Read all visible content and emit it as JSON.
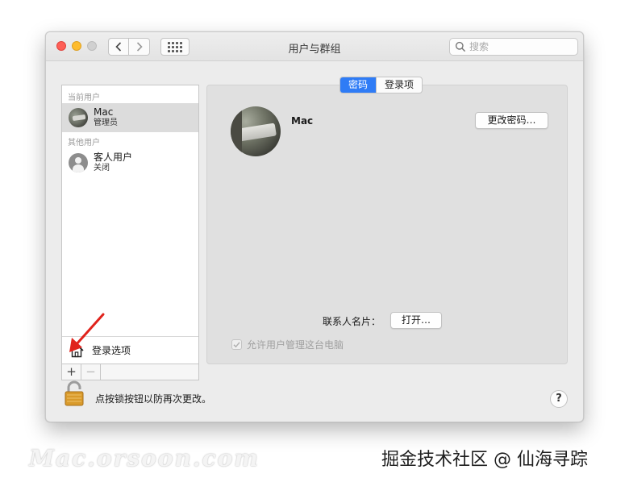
{
  "window": {
    "title": "用户与群组",
    "search_placeholder": "搜索"
  },
  "sidebar": {
    "current_users_label": "当前用户",
    "other_users_label": "其他用户",
    "current_user": {
      "name": "Mac",
      "role": "管理员"
    },
    "guest_user": {
      "name": "客人用户",
      "role": "关闭"
    },
    "login_options_label": "登录选项",
    "add_label": "+",
    "remove_label": "−"
  },
  "main": {
    "tabs": [
      {
        "label": "密码",
        "active": true
      },
      {
        "label": "登录项",
        "active": false
      }
    ],
    "account_name": "Mac",
    "change_password_label": "更改密码…",
    "contact_card_label": "联系人名片：",
    "open_label": "打开…",
    "allow_admin_label": "允许用户管理这台电脑"
  },
  "footer": {
    "lock_text": "点按锁按钮以防再次更改。",
    "help_label": "?"
  },
  "watermarks": {
    "left": "Mac.orsoon.com",
    "right": "掘金技术社区 @ 仙海寻踪"
  },
  "colors": {
    "accent": "#2f7cf6",
    "arrow": "#e0231c"
  }
}
